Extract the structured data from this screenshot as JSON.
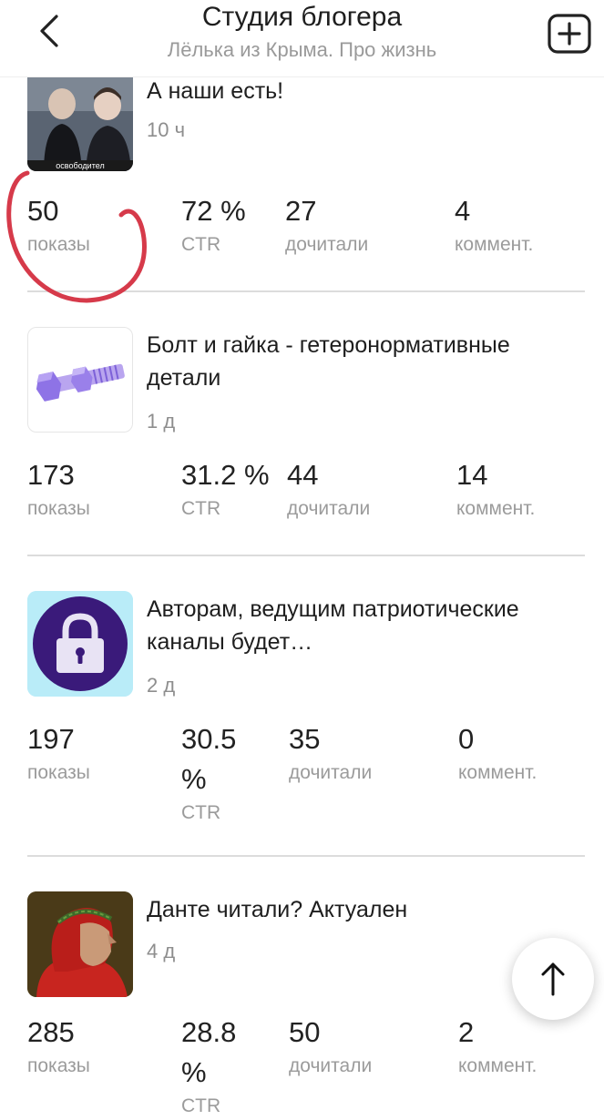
{
  "header": {
    "title": "Студия блогера",
    "subtitle": "Лёлька из Крыма. Про жизнь"
  },
  "posts": [
    {
      "title": "А наши есть!",
      "time": "10 ч",
      "thumb_caption": "освободител",
      "stats": [
        {
          "value": "50",
          "label": "показы"
        },
        {
          "value": "72 %",
          "label": "CTR"
        },
        {
          "value": "27",
          "label": "дочитали"
        },
        {
          "value": "4",
          "label": "коммент."
        }
      ]
    },
    {
      "title": "Болт и гайка - гетеронормативные детали",
      "time": "1 д",
      "stats": [
        {
          "value": "173",
          "label": "показы"
        },
        {
          "value": "31.2 %",
          "label": "CTR"
        },
        {
          "value": "44",
          "label": "дочитали"
        },
        {
          "value": "14",
          "label": "коммент."
        }
      ]
    },
    {
      "title": "Авторам, ведущим патриотические каналы будет…",
      "time": "2 д",
      "stats": [
        {
          "value": "197",
          "label": "показы"
        },
        {
          "value": "30.5 %",
          "label": "CTR"
        },
        {
          "value": "35",
          "label": "дочитали"
        },
        {
          "value": "0",
          "label": "коммент."
        }
      ]
    },
    {
      "title": "Данте читали? Актуален",
      "time": "4 д",
      "stats": [
        {
          "value": "285",
          "label": "показы"
        },
        {
          "value": "28.8 %",
          "label": "CTR"
        },
        {
          "value": "50",
          "label": "дочитали"
        },
        {
          "value": "2",
          "label": "коммент."
        }
      ]
    }
  ],
  "colors": {
    "annotation_circle": "#d63a4a",
    "lock_bg": "#b9ecf8",
    "lock_circle": "#3a1a7a"
  },
  "icons": {
    "back": "chevron-left-icon",
    "add": "plus-square-icon",
    "scroll_top": "arrow-up-icon"
  }
}
